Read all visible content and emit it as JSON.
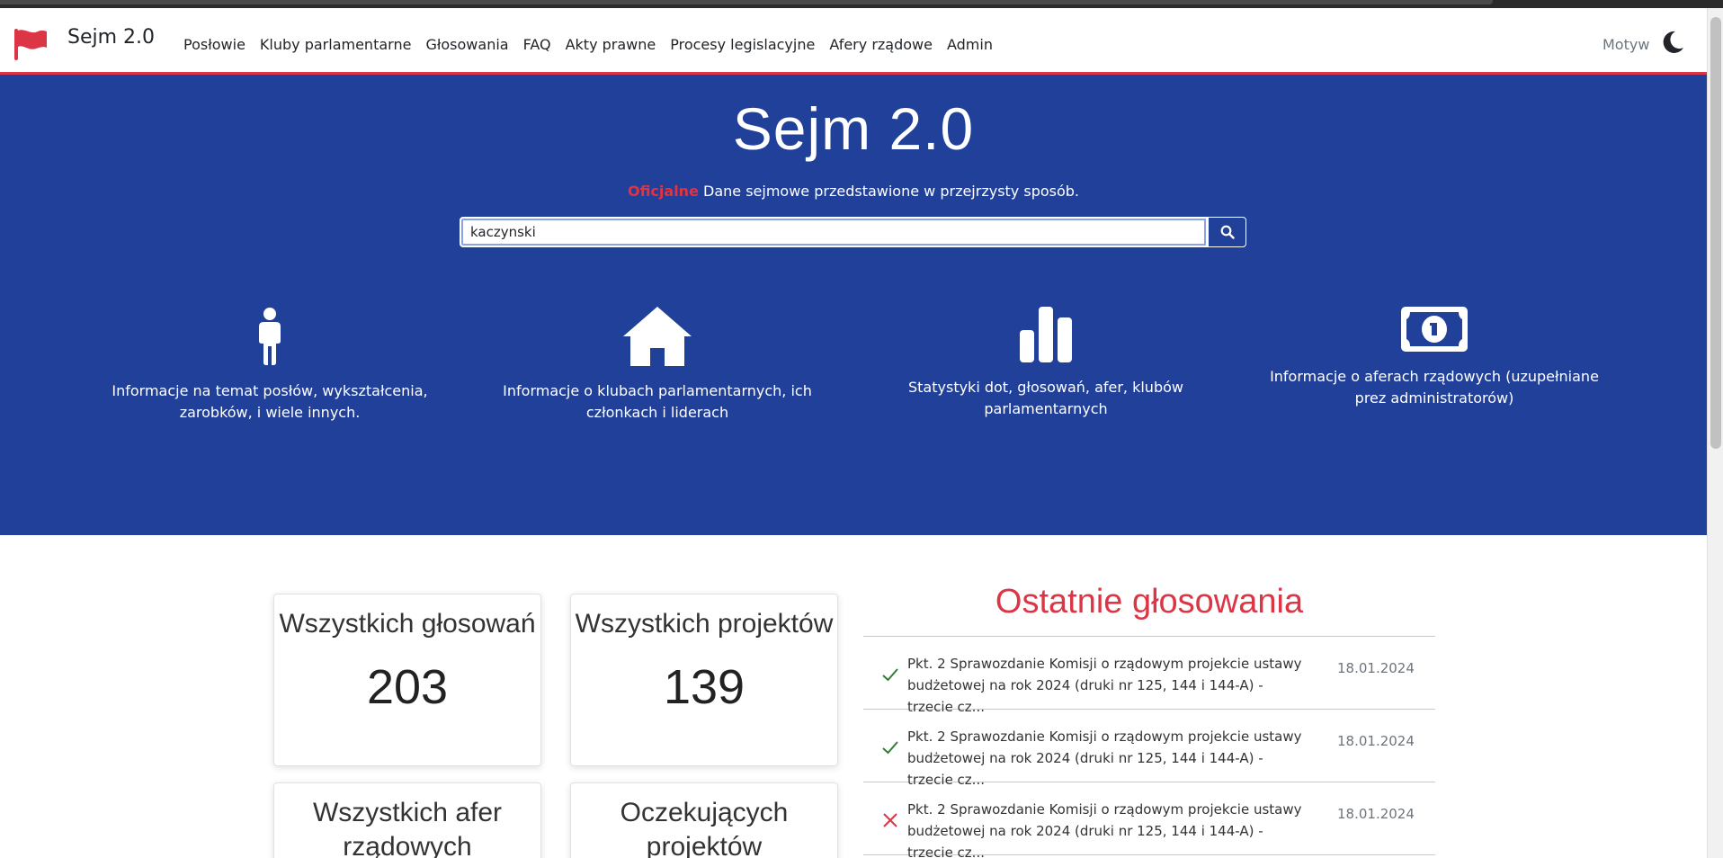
{
  "brand": {
    "name": "Sejm 2.0",
    "flag_color": "#dc3545"
  },
  "nav": {
    "items": [
      "Posłowie",
      "Kluby parlamentarne",
      "Głosowania",
      "FAQ",
      "Akty prawne",
      "Procesy legislacyjne",
      "Afery rządowe",
      "Admin"
    ],
    "theme_label": "Motyw",
    "theme_icon": "moon-icon"
  },
  "hero": {
    "title": "Sejm 2.0",
    "subtitle_accent": "Oficjalne",
    "subtitle_rest": " Dane sejmowe przedstawione w przejrzysty sposób.",
    "search_value": "kaczynski",
    "search_icon": "search-icon",
    "background": "#21409a",
    "accent": "#e4323f"
  },
  "features": [
    {
      "icon": "person-icon",
      "text": "Informacje na temat posłów, wykształcenia, zarobków, i wiele innych."
    },
    {
      "icon": "house-icon",
      "text": "Informacje o klubach parlamentarnych, ich członkach i liderach"
    },
    {
      "icon": "bar-chart-icon",
      "text": "Statystyki dot, głosowań, afer, klubów parlamentarnych"
    },
    {
      "icon": "money-icon",
      "text": "Informacje o aferach rządowych (uzupełniane prez administratorów)"
    }
  ],
  "stats": [
    {
      "label": "Wszystkich głosowań",
      "value": "203"
    },
    {
      "label": "Wszystkich projektów",
      "value": "139"
    },
    {
      "label": "Wszystkich afer rządowych",
      "value": ""
    },
    {
      "label": "Oczekujących projektów",
      "value": ""
    }
  ],
  "recent_votes": {
    "title": "Ostatnie głosowania",
    "items": [
      {
        "status": "check-icon",
        "text": "Pkt. 2 Sprawozdanie Komisji o rządowym projekcie ustawy budżetowej na rok 2024 (druki nr 125, 144 i 144-A) - trzecie cz...",
        "date": "18.01.2024"
      },
      {
        "status": "check-icon",
        "text": "Pkt. 2 Sprawozdanie Komisji o rządowym projekcie ustawy budżetowej na rok 2024 (druki nr 125, 144 i 144-A) - trzecie cz...",
        "date": "18.01.2024"
      },
      {
        "status": "cross-icon",
        "text": "Pkt. 2 Sprawozdanie Komisji o rządowym projekcie ustawy budżetowej na rok 2024 (druki nr 125, 144 i 144-A) - trzecie cz...",
        "date": "18.01.2024"
      }
    ],
    "colors": {
      "check": "#2e7d32",
      "cross": "#dc3545"
    }
  }
}
